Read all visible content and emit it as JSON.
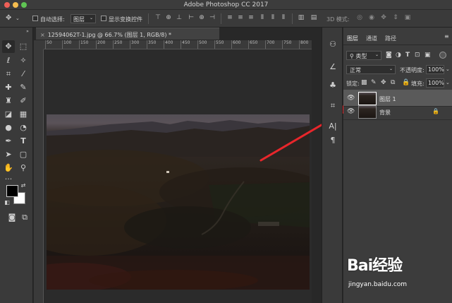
{
  "window": {
    "title": "Adobe Photoshop CC 2017"
  },
  "options": {
    "auto_select_label": "自动选择:",
    "auto_select_value": "图层",
    "show_transform_label": "显示变换控件",
    "mode_3d": "3D 模式:"
  },
  "document": {
    "tab_title": "12594062T-1.jpg @ 66.7% (图层 1, RGB/8) *",
    "ruler_ticks": [
      "50",
      "100",
      "150",
      "200",
      "250",
      "300",
      "350",
      "400",
      "450",
      "500",
      "550",
      "600",
      "650",
      "700",
      "750",
      "800"
    ]
  },
  "layers_panel": {
    "tabs": [
      "图层",
      "通道",
      "路径"
    ],
    "filter_kind": "类型",
    "blend_mode": "正常",
    "opacity_label": "不透明度:",
    "opacity_value": "100%",
    "lock_label": "锁定:",
    "fill_label": "填充:",
    "fill_value": "100%",
    "layers": [
      {
        "name": "图层 1",
        "visible": true,
        "selected": true,
        "locked": false
      },
      {
        "name": "背景",
        "visible": true,
        "selected": false,
        "locked": true
      }
    ]
  },
  "watermark": {
    "logo": "Bai经验",
    "url": "jingyan.baidu.com"
  },
  "colors": {
    "annotation_arrow": "#e8262b",
    "foreground": "#000000",
    "background": "#ffffff"
  }
}
